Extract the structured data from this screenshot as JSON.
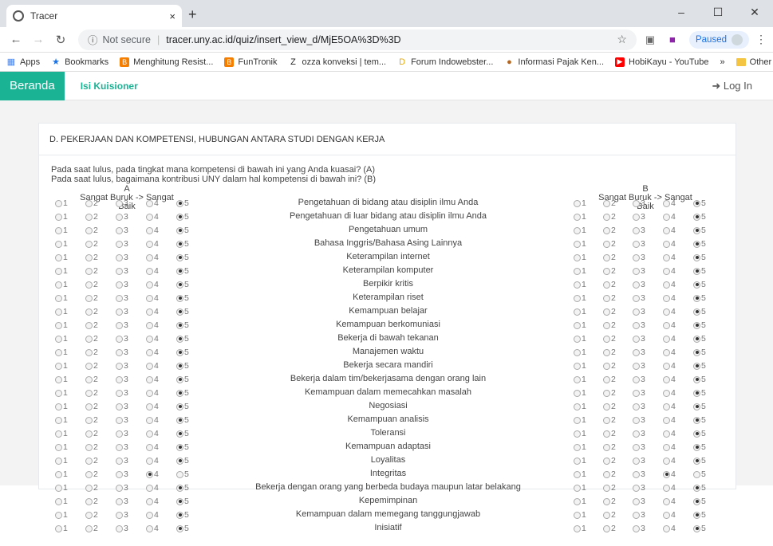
{
  "browser": {
    "tab_title": "Tracer",
    "tab_close": "×",
    "new_tab": "+",
    "not_secure": "Not secure",
    "url": "tracer.uny.ac.id/quiz/insert_view_d/MjE5OA%3D%3D",
    "paused_label": "Paused",
    "bookmarks": [
      {
        "label": "Apps",
        "icon": "apps-icon",
        "color": "#4285f4"
      },
      {
        "label": "Bookmarks",
        "icon": "star-icon",
        "color": "#1a73e8"
      },
      {
        "label": "Menghitung Resist...",
        "icon": "blogger-icon",
        "color": "#f57d00"
      },
      {
        "label": "FunTronik",
        "icon": "blogger-icon",
        "color": "#f57d00"
      },
      {
        "label": "ozza konveksi | tem...",
        "icon": "z-icon",
        "color": "#222222"
      },
      {
        "label": "Forum Indowebster...",
        "icon": "d-icon",
        "color": "#e6a800"
      },
      {
        "label": "Informasi Pajak Ken...",
        "icon": "globe-icon",
        "color": "#b5651d"
      },
      {
        "label": "HobiKayu - YouTube",
        "icon": "youtube-icon",
        "color": "#ff0000"
      }
    ],
    "more_bookmarks": "»",
    "other_bookmarks": "Other bookmarks"
  },
  "site": {
    "brand": "Beranda",
    "nav_link": "Isi Kuisioner",
    "login": "Log In"
  },
  "section": {
    "title": "D. PEKERJAAN DAN KOMPETENSI, HUBUNGAN ANTARA STUDI DENGAN KERJA",
    "question_a": "Pada saat lulus, pada tingkat mana kompetensi di bawah ini yang Anda kuasai? (A)",
    "question_b": "Pada saat lulus, bagaimana kontribusi UNY dalam hal kompetensi di bawah ini? (B)",
    "col_a_letter": "A",
    "col_a_scale": "Sangat Buruk -> Sangat Baik",
    "col_b_letter": "B",
    "col_b_scale": "Sangat Buruk -> Sangat Baik",
    "scale": [
      "1",
      "2",
      "3",
      "4",
      "5"
    ],
    "rows": [
      {
        "label": "Pengetahuan di bidang atau disiplin ilmu Anda",
        "a": 5,
        "b": 5
      },
      {
        "label": "Pengetahuan di luar bidang atau disiplin ilmu Anda",
        "a": 5,
        "b": 5
      },
      {
        "label": "Pengetahuan umum",
        "a": 5,
        "b": 5
      },
      {
        "label": "Bahasa Inggris/Bahasa Asing Lainnya",
        "a": 5,
        "b": 5
      },
      {
        "label": "Keterampilan internet",
        "a": 5,
        "b": 5
      },
      {
        "label": "Keterampilan komputer",
        "a": 5,
        "b": 5
      },
      {
        "label": "Berpikir kritis",
        "a": 5,
        "b": 5
      },
      {
        "label": "Keterampilan riset",
        "a": 5,
        "b": 5
      },
      {
        "label": "Kemampuan belajar",
        "a": 5,
        "b": 5
      },
      {
        "label": "Kemampuan berkomuniasi",
        "a": 5,
        "b": 5
      },
      {
        "label": "Bekerja di bawah tekanan",
        "a": 5,
        "b": 5
      },
      {
        "label": "Manajemen waktu",
        "a": 5,
        "b": 5
      },
      {
        "label": "Bekerja secara mandiri",
        "a": 5,
        "b": 5
      },
      {
        "label": "Bekerja dalam tim/bekerjasama dengan orang lain",
        "a": 5,
        "b": 5
      },
      {
        "label": "Kemampuan dalam memecahkan masalah",
        "a": 5,
        "b": 5
      },
      {
        "label": "Negosiasi",
        "a": 5,
        "b": 5
      },
      {
        "label": "Kemampuan analisis",
        "a": 5,
        "b": 5
      },
      {
        "label": "Toleransi",
        "a": 5,
        "b": 5
      },
      {
        "label": "Kemampuan adaptasi",
        "a": 5,
        "b": 5
      },
      {
        "label": "Loyalitas",
        "a": 5,
        "b": 5
      },
      {
        "label": "Integritas",
        "a": 4,
        "b": 4
      },
      {
        "label": "Bekerja dengan orang yang berbeda budaya maupun latar belakang",
        "a": 5,
        "b": 5
      },
      {
        "label": "Kepemimpinan",
        "a": 5,
        "b": 5
      },
      {
        "label": "Kemampuan dalam memegang tanggungjawab",
        "a": 5,
        "b": 5
      },
      {
        "label": "Inisiatif",
        "a": 5,
        "b": 5
      }
    ]
  }
}
